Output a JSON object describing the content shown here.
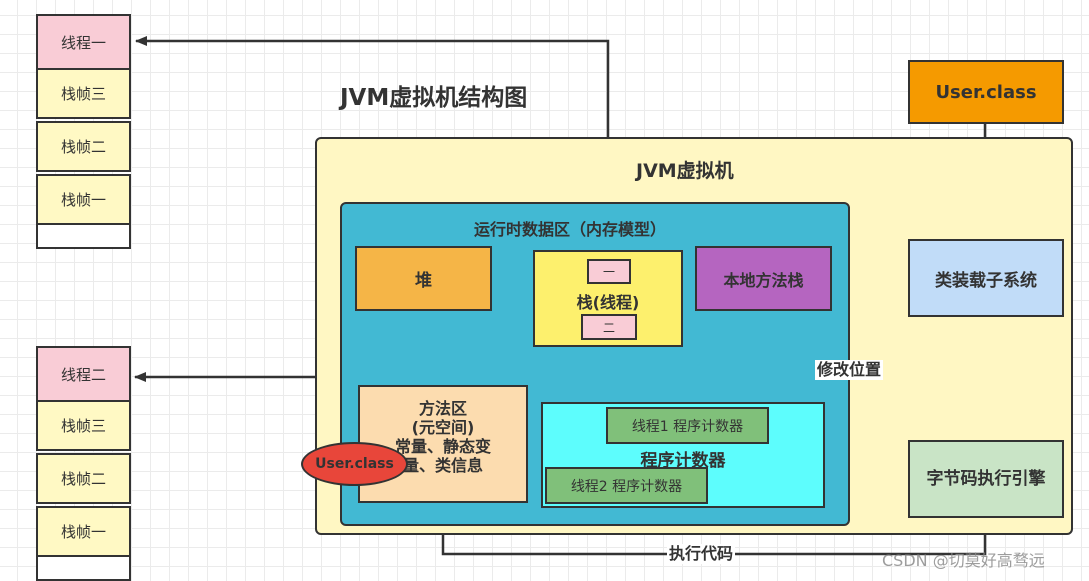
{
  "title": "JVM虚拟机结构图",
  "colors": {
    "thread": "#f9ccd6",
    "frame": "#fff9c4",
    "jvm_container": "#fff7c3",
    "runtime_area": "#42b9d3",
    "heap": "#f5b547",
    "stack": "#fdf06d",
    "native_stack": "#b565c0",
    "class_loader": "#c1dcf8",
    "user_class": "#f59a00",
    "method_area": "#fcdcaf",
    "pc_container": "#5dfdfd",
    "pc_thread": "#80c07a",
    "exec_engine": "#c9e4c6",
    "user_class_ellipse": "#e8463a",
    "line": "#333333"
  },
  "thread_stacks": [
    {
      "thread": "线程一",
      "frames": [
        "栈帧三",
        "栈帧二",
        "栈帧一"
      ]
    },
    {
      "thread": "线程二",
      "frames": [
        "栈帧三",
        "栈帧二",
        "栈帧一"
      ]
    }
  ],
  "user_class": "User.class",
  "jvm": {
    "label": "JVM虚拟机",
    "runtime_area": {
      "label": "运行时数据区（内存模型）",
      "heap": "堆",
      "stack": {
        "label": "栈(线程)",
        "slots": [
          "一",
          "二"
        ]
      },
      "native_stack": "本地方法栈",
      "method_area": {
        "line1": "方法区",
        "line2": "(元空间)",
        "line3": "常量、静态变",
        "line4": "量、类信息"
      },
      "program_counter": {
        "label": "程序计数器",
        "thread1": "线程1 程序计数器",
        "thread2": "线程2 程序计数器"
      }
    },
    "class_loader": "类装载子系统",
    "exec_engine": "字节码执行引擎"
  },
  "user_class_ellipse": "User.class",
  "edge_labels": {
    "modify_position": "修改位置",
    "execute_code": "执行代码"
  },
  "watermark": "CSDN @切莫好高骛远"
}
